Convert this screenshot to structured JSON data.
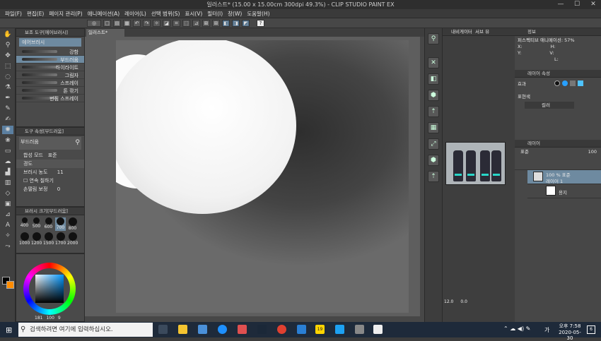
{
  "window": {
    "title": "일러스트* (15.00 x 15.00cm 300dpi 49.3%) - CLIP STUDIO PAINT EX",
    "minimize": "—",
    "maximize": "☐",
    "close": "✕"
  },
  "menu": [
    "파일(F)",
    "편집(E)",
    "페이지 관리(P)",
    "애니메이션(A)",
    "레이어(L)",
    "선택 범위(S)",
    "표시(V)",
    "필터(I)",
    "창(W)",
    "도움말(H)"
  ],
  "colors": {
    "accent_teal": "#28d6c8",
    "color_fg": "#000000",
    "color_bg": "#ff8c00",
    "selected_row": "#6e8aa0"
  },
  "subtool_panel": {
    "title": "보조 도구[에어브러시]",
    "group": "에어브러시",
    "brushes": [
      "강함",
      "부드러움",
      "하이라이트",
      "그림자",
      "스프레이",
      "톤 깎기",
      "번짐 스프레이"
    ],
    "selected_brush": "부드러움"
  },
  "tool_property": {
    "title": "도구 속성[부드러움]",
    "brush_name": "부드러움",
    "blend_mode_label": "합성 모드",
    "blend_mode_value": "표준",
    "hardness_label": "경도",
    "density_label": "브러시 농도",
    "density_value": "11",
    "continuous_label": "연속 칠하기",
    "stabilizer_label": "손떨림 보정",
    "stabilizer_value": "0"
  },
  "brush_size_panel": {
    "title": "브러시 크기[부드러움]",
    "sizes": [
      "400",
      "500",
      "600",
      "700",
      "800",
      "1000",
      "1200",
      "1500",
      "1700",
      "2000"
    ],
    "selected": "700"
  },
  "color_panel": {
    "value_h": "181",
    "value_s": "100",
    "value_v": "9"
  },
  "canvas_tab": "일러스트*",
  "navigator": {
    "tab1": "내비게이터",
    "tab2": "서브 뷰",
    "zoom": "12.0",
    "rotation": "0.0"
  },
  "info_panel": {
    "title": "정보",
    "line1": "퍼스펙티브 애니메이션: 57%",
    "x_label": "X:",
    "y_label": "Y:",
    "h_label": "H:",
    "v_label": "V:",
    "l_label": "L:"
  },
  "layer_property": {
    "title": "레이어 속성",
    "effect_label": "효과",
    "expression_label": "표현색",
    "expression_value": "컬러"
  },
  "layer_panel": {
    "title": "레이어",
    "blend_mode": "표준",
    "opacity": "100",
    "layers": [
      {
        "line1": "100 % 표준",
        "line2": "레이어 1",
        "selected": true
      },
      {
        "line1": "",
        "line2": "용지",
        "selected": false
      }
    ]
  },
  "taskbar": {
    "search_placeholder": "검색하려면 여기에 입력하십시오.",
    "time": "오후 7:58",
    "date": "2020-05-30",
    "ime": "가",
    "notification_count": "6",
    "badge": "19"
  }
}
